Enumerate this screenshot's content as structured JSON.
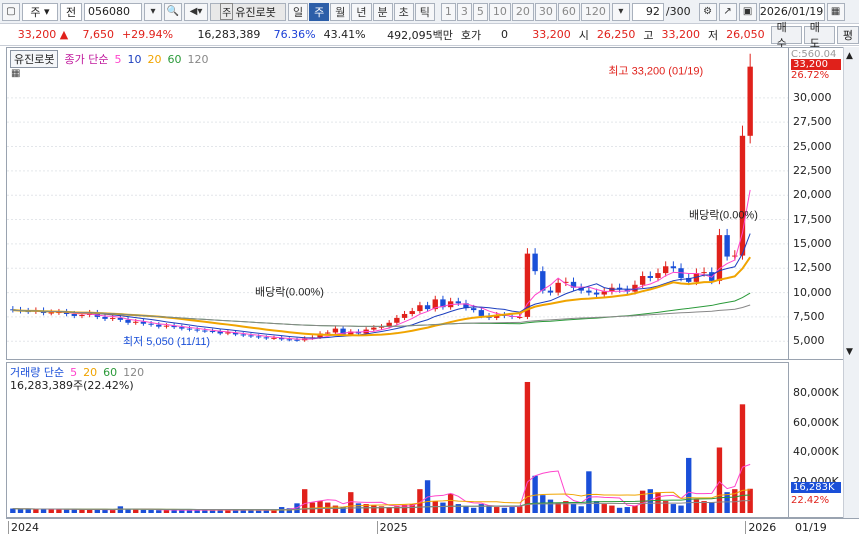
{
  "toolbar": {
    "market": "주",
    "type": "전",
    "code": "056080",
    "stock_tag": "주",
    "stock_name": "유진로봇",
    "periods": [
      {
        "label": "일",
        "active": false
      },
      {
        "label": "주",
        "active": true
      },
      {
        "label": "월",
        "active": false
      },
      {
        "label": "년",
        "active": false
      },
      {
        "label": "분",
        "active": false
      },
      {
        "label": "초",
        "active": false
      },
      {
        "label": "틱",
        "active": false
      }
    ],
    "intervals": [
      "1",
      "3",
      "5",
      "10",
      "20",
      "30",
      "60",
      "120"
    ],
    "count": "92",
    "count_max": "/300",
    "date": "2026/01/19"
  },
  "quote": {
    "price": "33,200",
    "change": "7,650",
    "change_pct": "+29.94%",
    "volume": "16,283,389",
    "ratio1": "76.36%",
    "ratio2": "43.41%",
    "amount": "492,095백만",
    "hoga_label": "호가",
    "hoga_value": "0",
    "ask": "33,200",
    "open_label": "시",
    "open": "26,250",
    "high_label": "고",
    "high": "33,200",
    "low_label": "저",
    "low": "26,050",
    "buy_label": "매수",
    "sell_label": "매도",
    "eval_label": "평"
  },
  "price_legend": {
    "name": "유진로봇",
    "ma_title": "종가 단순",
    "periods": [
      "5",
      "10",
      "20",
      "60",
      "120"
    ]
  },
  "volume_legend": {
    "title": "거래량 단순",
    "periods": [
      "5",
      "20",
      "60",
      "120"
    ],
    "value": "16,283,389주(22.42%)"
  },
  "annotations": {
    "high_note": "최고 33,200 (01/19)",
    "low_note": "최저 5,050 (11/11)",
    "dividend1": "배당락(0.00%)",
    "dividend2": "배당락(0.00%)"
  },
  "price_axis": {
    "top_label": "C:560.04",
    "current": "33,200",
    "current_pct": "26.72%",
    "ticks": [
      "30,000",
      "27,500",
      "25,000",
      "22,500",
      "20,000",
      "17,500",
      "15,000",
      "12,500",
      "10,000",
      "7,500",
      "5,000"
    ]
  },
  "volume_axis": {
    "ticks": [
      "80,000K",
      "60,000K",
      "40,000K",
      "20,000K"
    ],
    "current": "16,283K",
    "current_pct": "22.42%"
  },
  "x_axis": {
    "labels": [
      "2024",
      "2025",
      "2026"
    ],
    "right_label": "01/19"
  },
  "colors": {
    "up": "#e0211b",
    "down": "#1a4fd8",
    "ma5": "#ff44cc",
    "ma10": "#1c3fbf",
    "ma20": "#f0a400",
    "ma60": "#2b9a3a",
    "ma120": "#888888"
  },
  "chart_data": {
    "type": "candlestick",
    "x": [
      "2024-01",
      "2024-01",
      "2024-01",
      "2024-01",
      "2024-02",
      "2024-02",
      "2024-02",
      "2024-02",
      "2024-03",
      "2024-03",
      "2024-03",
      "2024-03",
      "2024-04",
      "2024-04",
      "2024-04",
      "2024-04",
      "2024-05",
      "2024-05",
      "2024-05",
      "2024-05",
      "2024-06",
      "2024-06",
      "2024-06",
      "2024-06",
      "2024-07",
      "2024-07",
      "2024-07",
      "2024-07",
      "2024-08",
      "2024-08",
      "2024-08",
      "2024-08",
      "2024-09",
      "2024-09",
      "2024-09",
      "2024-09",
      "2024-10",
      "2024-10",
      "2024-10",
      "2024-10",
      "2024-11",
      "2024-11",
      "2024-11",
      "2024-11",
      "2024-12",
      "2024-12",
      "2024-12",
      "2024-12",
      "2025-01",
      "2025-01",
      "2025-01",
      "2025-01",
      "2025-02",
      "2025-02",
      "2025-02",
      "2025-02",
      "2025-03",
      "2025-03",
      "2025-03",
      "2025-03",
      "2025-04",
      "2025-04",
      "2025-04",
      "2025-04",
      "2025-05",
      "2025-05",
      "2025-05",
      "2025-05",
      "2025-06",
      "2025-06",
      "2025-06",
      "2025-06",
      "2025-07",
      "2025-07",
      "2025-07",
      "2025-07",
      "2025-08",
      "2025-08",
      "2025-08",
      "2025-08",
      "2025-09",
      "2025-09",
      "2025-09",
      "2025-09",
      "2025-10",
      "2025-10",
      "2025-10",
      "2025-10",
      "2025-11",
      "2025-11",
      "2025-11",
      "2025-11",
      "2025-12",
      "2025-12",
      "2025-12",
      "2025-12",
      "2026-01",
      "2026-01"
    ],
    "close": [
      8200,
      8100,
      8050,
      8150,
      7900,
      7950,
      8000,
      7800,
      7600,
      7700,
      7900,
      7500,
      7300,
      7400,
      7200,
      6900,
      7000,
      6800,
      6700,
      6500,
      6600,
      6450,
      6300,
      6200,
      6100,
      6050,
      6000,
      5800,
      5900,
      5700,
      5600,
      5500,
      5400,
      5300,
      5350,
      5200,
      5150,
      5100,
      5300,
      5400,
      5800,
      5900,
      6300,
      5700,
      6000,
      5800,
      6200,
      6400,
      6500,
      6900,
      7400,
      7800,
      8100,
      8700,
      8300,
      9300,
      8500,
      9100,
      8900,
      8400,
      8200,
      7600,
      7400,
      7700,
      7600,
      7500,
      7500,
      14000,
      12200,
      10200,
      10000,
      11000,
      11100,
      10500,
      10200,
      10000,
      9800,
      10100,
      10500,
      10300,
      10100,
      10800,
      11700,
      11500,
      12000,
      12700,
      12500,
      11500,
      11100,
      12000,
      12100,
      11200,
      15900,
      13700,
      13800,
      26100,
      33200
    ],
    "volume_k": [
      3000,
      2500,
      2800,
      2400,
      2600,
      2900,
      2500,
      2300,
      2400,
      2200,
      2500,
      2300,
      2100,
      2000,
      4500,
      2500,
      2300,
      2100,
      2000,
      1900,
      2100,
      1800,
      2000,
      1900,
      2000,
      1800,
      1700,
      2200,
      1800,
      1900,
      2200,
      1700,
      1600,
      1800,
      2000,
      4000,
      3200,
      6500,
      16000,
      7000,
      8000,
      7000,
      5000,
      4000,
      14000,
      6500,
      6000,
      5000,
      4500,
      4000,
      4500,
      5500,
      6000,
      16000,
      22000,
      8000,
      7000,
      13000,
      6000,
      4500,
      3500,
      6000,
      5000,
      4000,
      3500,
      4000,
      4500,
      88000,
      25000,
      12000,
      9000,
      7000,
      8000,
      6000,
      4500,
      28000,
      8000,
      6000,
      5000,
      3500,
      4000,
      5000,
      15000,
      16000,
      14000,
      8000,
      6000,
      5000,
      37000,
      9000,
      8000,
      7000,
      44000,
      14000,
      16000,
      73000,
      16283
    ],
    "y_range": [
      4000,
      34500
    ],
    "y_volume_range": [
      0,
      90000
    ],
    "high_point": {
      "label": "최고",
      "value": 33200,
      "date": "01/19"
    },
    "low_point": {
      "label": "최저",
      "value": 5050,
      "date": "11/11"
    }
  }
}
